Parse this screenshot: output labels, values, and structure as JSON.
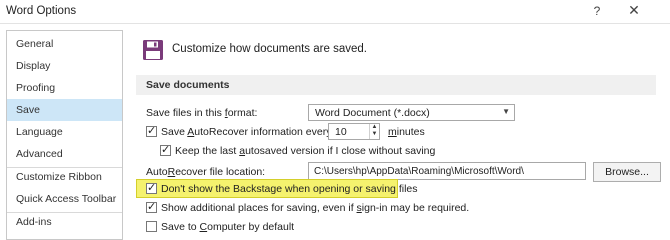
{
  "window": {
    "title": "Word Options",
    "help_label": "?",
    "close_label": "✕"
  },
  "sidebar": {
    "items": [
      {
        "label": "General"
      },
      {
        "label": "Display"
      },
      {
        "label": "Proofing"
      },
      {
        "label": "Save",
        "selected": true
      },
      {
        "label": "Language"
      },
      {
        "label": "Advanced"
      },
      {
        "label": "Customize Ribbon"
      },
      {
        "label": "Quick Access Toolbar"
      },
      {
        "label": "Add-ins"
      }
    ]
  },
  "header": {
    "icon": "floppy-disk-icon",
    "text": "Customize how documents are saved."
  },
  "save_documents": {
    "section_title": "Save documents",
    "format_label_pre": "Save files in this ",
    "format_label_key": "f",
    "format_label_post": "ormat:",
    "format_value": "Word Document (*.docx)",
    "autorecover_pre": "Save ",
    "autorecover_key": "A",
    "autorecover_post": "utoRecover information every",
    "autorecover_checked": true,
    "autorecover_minutes": "10",
    "minutes_key": "m",
    "minutes_post": "inutes",
    "keep_last_pre": "Keep the last ",
    "keep_last_key": "a",
    "keep_last_post": "utosaved version if I close without saving",
    "keep_last_checked": true,
    "location_pre": "Auto",
    "location_key": "R",
    "location_post": "ecover file location:",
    "location_value": "C:\\Users\\hp\\AppData\\Roaming\\Microsoft\\Word\\",
    "browse_label": "Browse...",
    "backstage_label": "Don't show the Backstage when opening or saving files",
    "backstage_checked": true,
    "additional_pre": "Show additional places for saving, even if ",
    "additional_key": "s",
    "additional_post": "ign-in may be required.",
    "additional_checked": true,
    "computer_pre": "Save to ",
    "computer_key": "C",
    "computer_post": "omputer by default",
    "computer_checked": false
  },
  "colors": {
    "selected_nav": "#cde6f7",
    "highlight": "#f5f26e",
    "floppy": "#7a3b7a"
  }
}
